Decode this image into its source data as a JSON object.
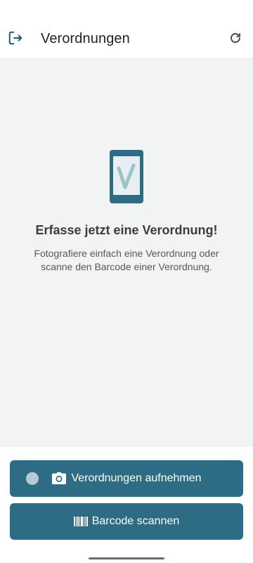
{
  "header": {
    "title": "Verordnungen",
    "logout_icon": "logout-icon",
    "refresh_icon": "refresh-icon"
  },
  "empty_state": {
    "illustration": "phone-check-icon",
    "title": "Erfasse jetzt eine Verordnung!",
    "description": "Fotografiere einfach eine Verordnung oder scanne den Barcode einer Verordnung."
  },
  "actions": {
    "capture_label": "Verordnungen aufnehmen",
    "capture_icon": "camera-icon",
    "scan_label": "Barcode scannen",
    "scan_icon": "barcode-icon"
  },
  "colors": {
    "primary": "#2e6c85",
    "background": "#f2f3f3",
    "title_text": "#3a3d3e",
    "accent_light": "#9cc3cc"
  }
}
